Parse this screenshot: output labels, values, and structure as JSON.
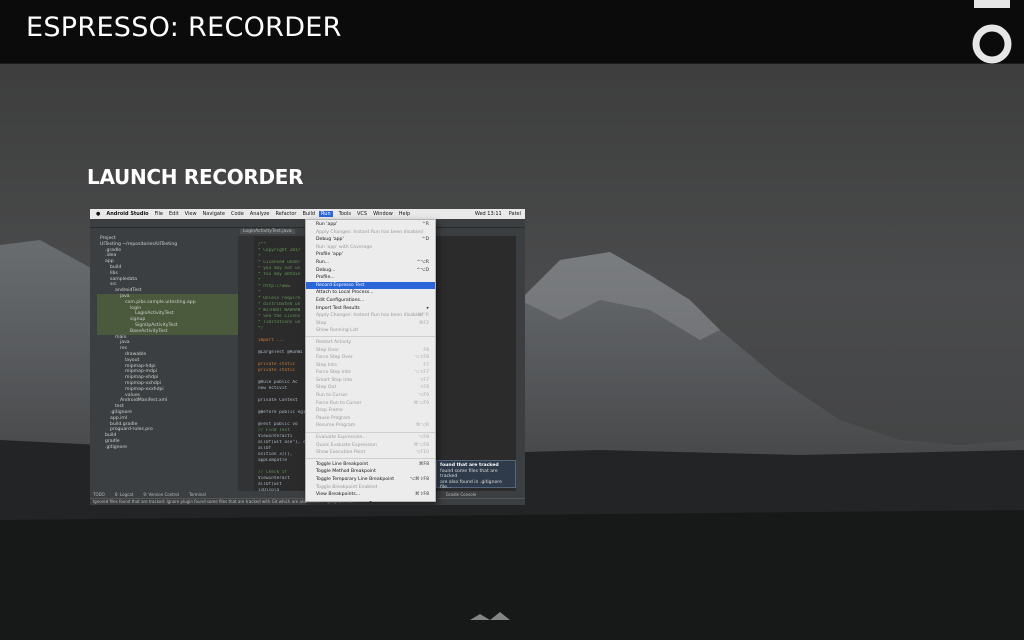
{
  "slide": {
    "title": "ESPRESSO: RECORDER",
    "heading": "LAUNCH RECORDER"
  },
  "mac_menubar": {
    "items": [
      "Android Studio",
      "File",
      "Edit",
      "View",
      "Navigate",
      "Code",
      "Analyze",
      "Refactor",
      "Build"
    ],
    "selected": "Run",
    "after": [
      "Tools",
      "VCS",
      "Window",
      "Help"
    ],
    "clock": "Wed 13:11",
    "user": "Patel"
  },
  "tabs": [
    "LoginActivityTest.java",
    "SignUpActivityTest.java"
  ],
  "project_tree": [
    {
      "label": "Project",
      "depth": 0
    },
    {
      "label": "UITesting ~/repositories/UITesting",
      "depth": 0
    },
    {
      "label": ".gradle",
      "depth": 1
    },
    {
      "label": ".idea",
      "depth": 1
    },
    {
      "label": "app",
      "depth": 1
    },
    {
      "label": "build",
      "depth": 2
    },
    {
      "label": "libs",
      "depth": 2
    },
    {
      "label": "sampledata",
      "depth": 2
    },
    {
      "label": "src",
      "depth": 2
    },
    {
      "label": "androidTest",
      "depth": 3
    },
    {
      "label": "java",
      "depth": 4,
      "hl": true
    },
    {
      "label": "com.pibs.sample.uitesting.app",
      "depth": 5,
      "hl": true
    },
    {
      "label": "login",
      "depth": 6,
      "hl": true
    },
    {
      "label": "LoginActivityTest",
      "depth": 7,
      "hl": true
    },
    {
      "label": "signup",
      "depth": 6,
      "hl": true
    },
    {
      "label": "SignUpActivityTest",
      "depth": 7,
      "hl": true
    },
    {
      "label": "BaseActivityTest",
      "depth": 6,
      "hl": true
    },
    {
      "label": "main",
      "depth": 3
    },
    {
      "label": "java",
      "depth": 4
    },
    {
      "label": "res",
      "depth": 4
    },
    {
      "label": "drawable",
      "depth": 5
    },
    {
      "label": "layout",
      "depth": 5
    },
    {
      "label": "mipmap-hdpi",
      "depth": 5
    },
    {
      "label": "mipmap-mdpi",
      "depth": 5
    },
    {
      "label": "mipmap-xhdpi",
      "depth": 5
    },
    {
      "label": "mipmap-xxhdpi",
      "depth": 5
    },
    {
      "label": "mipmap-xxxhdpi",
      "depth": 5
    },
    {
      "label": "values",
      "depth": 5
    },
    {
      "label": "AndroidManifest.xml",
      "depth": 4
    },
    {
      "label": "test",
      "depth": 3
    },
    {
      "label": ".gitignore",
      "depth": 2
    },
    {
      "label": "app.iml",
      "depth": 2
    },
    {
      "label": "build.gradle",
      "depth": 2
    },
    {
      "label": "proguard-rules.pro",
      "depth": 2
    },
    {
      "label": "build",
      "depth": 1
    },
    {
      "label": "gradle",
      "depth": 1
    },
    {
      "label": ".gitignore",
      "depth": 1
    }
  ],
  "editor_lines": [
    {
      "t": "/**",
      "c": true
    },
    {
      "t": " * Copyright 2017",
      "c": true
    },
    {
      "t": " *",
      "c": true
    },
    {
      "t": " * Licensed under",
      "c": true
    },
    {
      "t": " * you may not us",
      "c": true
    },
    {
      "t": " * You may obtain",
      "c": true
    },
    {
      "t": " *",
      "c": true
    },
    {
      "t": " *    http://www.",
      "c": true
    },
    {
      "t": " *",
      "c": true
    },
    {
      "t": " * Unless require",
      "c": true
    },
    {
      "t": " * distributed un",
      "c": true
    },
    {
      "t": " * WITHOUT WARRAN",
      "c": true
    },
    {
      "t": " * See the Licens",
      "c": true
    },
    {
      "t": " * limitations un",
      "c": true
    },
    {
      "t": " */",
      "c": true
    },
    {
      "t": "",
      "c": false
    },
    {
      "t": "import ...",
      "k": true
    },
    {
      "t": "",
      "c": false
    },
    {
      "t": "@LargeTest @RunWi                                          tends BaseActivityTest {",
      "c": false
    },
    {
      "t": "",
      "c": false
    },
    {
      "t": "    private static",
      "k": true
    },
    {
      "t": "    private static",
      "k": true
    },
    {
      "t": "",
      "c": false
    },
    {
      "t": "    @Rule public Ac",
      "c": false
    },
    {
      "t": "        new Activit",
      "c": false
    },
    {
      "t": "",
      "c": false
    },
    {
      "t": "    private Context",
      "c": false
    },
    {
      "t": "",
      "c": false
    },
    {
      "t": "    @Before public                                             egistry.getContext();",
      "c": false
    },
    {
      "t": "",
      "c": false
    },
    {
      "t": "    @Test public vo",
      "c": false
    },
    {
      "t": "        // Find Text",
      "c": true
    },
    {
      "t": "        ViewInteracti",
      "c": false
    },
    {
      "t": "            allOf(wit                                        ase\"), childAtPosition(",
      "c": false
    },
    {
      "t": "              allOf",
      "c": false
    },
    {
      "t": "                                                             osition 3))),",
      "c": false
    },
    {
      "t": "        appCompatTe",
      "c": false
    },
    {
      "t": "",
      "c": false
    },
    {
      "t": "        // Check if",
      "c": true
    },
    {
      "t": "        ViewInteract",
      "c": false
    },
    {
      "t": "            allOf(wit",
      "c": false
    },
    {
      "t": "              isDispla",
      "c": false
    },
    {
      "t": "        textView.che",
      "c": false
    }
  ],
  "run_menu": [
    {
      "label": "Run 'app'",
      "shortcut": "^R"
    },
    {
      "label": "Apply Changes: Instant Run has been disabled",
      "disabled": true
    },
    {
      "label": "Debug 'app'",
      "shortcut": "^D"
    },
    {
      "label": "Run 'app' with Coverage",
      "disabled": true
    },
    {
      "label": "Profile 'app'"
    },
    {
      "label": "Run...",
      "shortcut": "^⌥R"
    },
    {
      "label": "Debug...",
      "shortcut": "^⌥D"
    },
    {
      "label": "Profile..."
    },
    {
      "label": "Record Espresso Test",
      "selected": true
    },
    {
      "label": "Attach to Local Process..."
    },
    {
      "label": "Edit Configurations..."
    },
    {
      "label": "Import Test Results",
      "shortcut": "▸"
    },
    {
      "label": "Apply Changes: Instant Run has been disabled",
      "disabled": true,
      "shortcut": "⌘⌃R"
    },
    {
      "label": "Stop",
      "disabled": true,
      "shortcut": "⌘F2"
    },
    {
      "label": "Show Running List",
      "disabled": true
    },
    {
      "sep": true
    },
    {
      "label": "Restart Activity",
      "disabled": true
    },
    {
      "label": "Step Over",
      "disabled": true,
      "shortcut": "F8"
    },
    {
      "label": "Force Step Over",
      "disabled": true,
      "shortcut": "⌥⇧F8"
    },
    {
      "label": "Step Into",
      "disabled": true,
      "shortcut": "F7"
    },
    {
      "label": "Force Step Into",
      "disabled": true,
      "shortcut": "⌥⇧F7"
    },
    {
      "label": "Smart Step Into",
      "disabled": true,
      "shortcut": "⇧F7"
    },
    {
      "label": "Step Out",
      "disabled": true,
      "shortcut": "⇧F8"
    },
    {
      "label": "Run to Cursor",
      "disabled": true,
      "shortcut": "⌥F9"
    },
    {
      "label": "Force Run to Cursor",
      "disabled": true,
      "shortcut": "⌘⌥F9"
    },
    {
      "label": "Drop Frame",
      "disabled": true
    },
    {
      "label": "Pause Program",
      "disabled": true
    },
    {
      "label": "Resume Program",
      "disabled": true,
      "shortcut": "⌘⌥R"
    },
    {
      "sep": true
    },
    {
      "label": "Evaluate Expression...",
      "disabled": true,
      "shortcut": "⌥F8"
    },
    {
      "label": "Quick Evaluate Expression",
      "disabled": true,
      "shortcut": "⌘⌥F8"
    },
    {
      "label": "Show Execution Point",
      "disabled": true,
      "shortcut": "⌥F10"
    },
    {
      "sep": true
    },
    {
      "label": "Toggle Line Breakpoint",
      "shortcut": "⌘F8"
    },
    {
      "label": "Toggle Method Breakpoint"
    },
    {
      "label": "Toggle Temporary Line Breakpoint",
      "shortcut": "⌥⌘⇧F8"
    },
    {
      "label": "Toggle Breakpoint Enabled",
      "disabled": true
    },
    {
      "label": "View Breakpoints...",
      "shortcut": "⌘⇧F8"
    }
  ],
  "notification": {
    "title": "found that are tracked",
    "line2": "found some files that are tracked",
    "line3": "are also found in .gitignore file..."
  },
  "bottom_tools": [
    "TODO",
    "6: Logcat",
    "9: Version Control",
    "Terminal",
    "Event Log",
    "Gradle Console"
  ],
  "status_text": "Ignored files found that are tracked: Ignore plugin found some files that are tracked with Git which are also listed in .gitignore file..."
}
